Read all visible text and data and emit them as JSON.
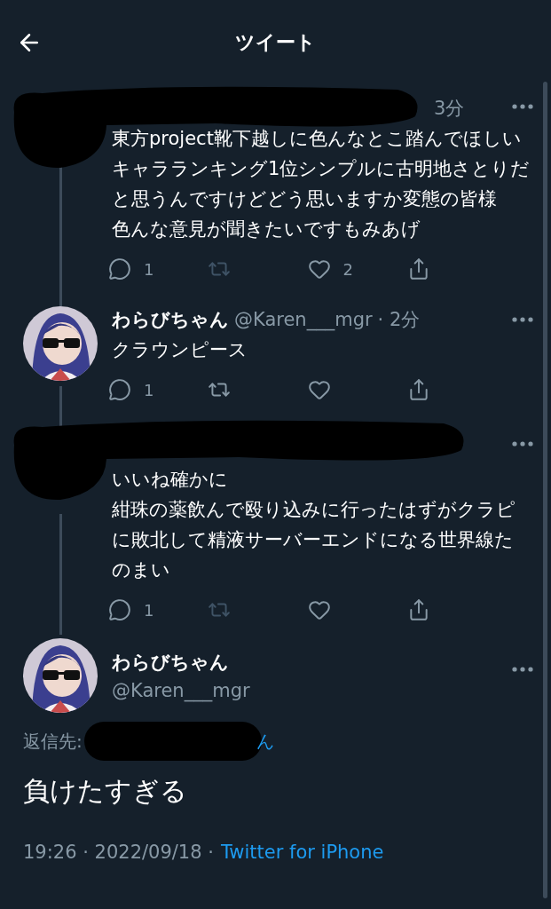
{
  "header": {
    "title": "ツイート"
  },
  "tweets": [
    {
      "kind": "redacted",
      "time": "3分",
      "text": [
        "東方project靴下越しに色んなとこ踏んでほしいキャラランキング1位シンプルに古明地さとりだと思うんですけどどう思いますか変態の皆様",
        "色んな意見が聞きたいですもみあげ"
      ],
      "actions": [
        {
          "kind": "reply",
          "count": "1",
          "disabled": false
        },
        {
          "kind": "retweet",
          "disabled": true
        },
        {
          "kind": "like",
          "count": "2",
          "disabled": false
        },
        {
          "kind": "share",
          "disabled": false
        }
      ]
    },
    {
      "kind": "user",
      "name": "わらびちゃん",
      "handle": "@Karen___mgr",
      "time": "· 2分",
      "text": [
        "クラウンピース"
      ],
      "actions": [
        {
          "kind": "reply",
          "count": "1",
          "disabled": false
        },
        {
          "kind": "retweet",
          "disabled": false
        },
        {
          "kind": "like",
          "disabled": false
        },
        {
          "kind": "share",
          "disabled": false
        }
      ]
    },
    {
      "kind": "redacted",
      "text": [
        "いいね確かに",
        "紺珠の薬飲んで殴り込みに行ったはずがクラピに敗北して精液サーバーエンドになる世界線たのまい"
      ],
      "actions": [
        {
          "kind": "reply",
          "count": "1",
          "disabled": false
        },
        {
          "kind": "retweet",
          "disabled": true
        },
        {
          "kind": "like",
          "disabled": false
        },
        {
          "kind": "share",
          "disabled": false
        }
      ]
    }
  ],
  "main": {
    "name": "わらびちゃん",
    "handle": "@Karen___mgr",
    "reply_label": "返信先:",
    "reply_tail": "ん",
    "text": "負けたすぎる",
    "timestamp": "19:26 · 2022/09/18 ·",
    "source": "Twitter for iPhone"
  }
}
